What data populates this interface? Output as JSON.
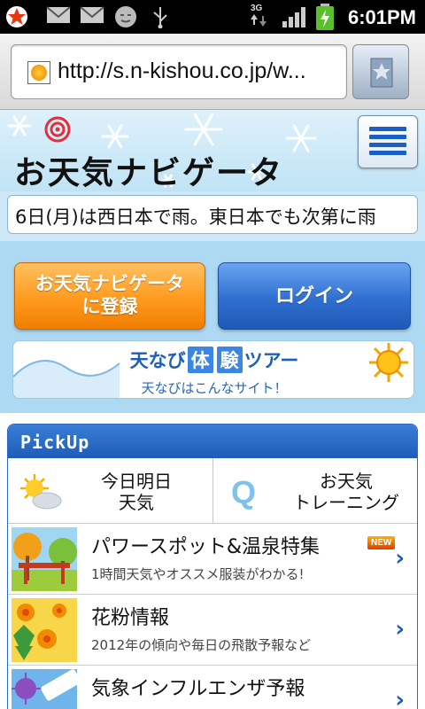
{
  "status_bar": {
    "time": "6:01PM",
    "network": "3G",
    "icons": [
      "notification-star-icon",
      "gmail-icon",
      "gmail-icon",
      "face-icon",
      "usb-icon",
      "network-3g-icon",
      "signal-icon",
      "battery-charging-icon"
    ]
  },
  "browser": {
    "url": "http://s.n-kishou.co.jp/w...",
    "bookmark_icon": "bookmark-star-icon"
  },
  "header": {
    "logo_text": "お天気ナビゲータ",
    "menu_icon": "menu-icon"
  },
  "ticker": {
    "text": "6日(月)は西日本で雨。東日本でも次第に雨"
  },
  "actions": {
    "register_line1": "お天気ナビゲータ",
    "register_line2": "に登録",
    "login": "ログイン"
  },
  "tour": {
    "title_pre": "天なび",
    "title_box1": "体",
    "title_box2": "験",
    "title_post": "ツアー",
    "subtitle": "天なびはこんなサイト！"
  },
  "pickup": {
    "header": "PickUp",
    "cells": [
      {
        "line1": "今日明日",
        "line2": "天気",
        "icon": "sun-cloud-icon"
      },
      {
        "line1": "お天気",
        "line2": "トレーニング",
        "icon": "q-icon",
        "icon_text": "Q"
      }
    ],
    "rows": [
      {
        "title": "パワースポット&温泉特集",
        "desc": "1時間天気やオススメ服装がわかる!",
        "badge": "NEW",
        "thumb": "power-spot-thumb"
      },
      {
        "title": "花粉情報",
        "desc": "2012年の傾向や毎日の飛散予報など",
        "thumb": "pollen-thumb"
      },
      {
        "title": "気象インフルエンザ予報",
        "desc": "",
        "thumb": "influenza-thumb"
      }
    ]
  },
  "colors": {
    "accent_blue": "#1d5cb8",
    "register_orange": "#ff9a1e",
    "panel_bg": "#aed9f3"
  }
}
